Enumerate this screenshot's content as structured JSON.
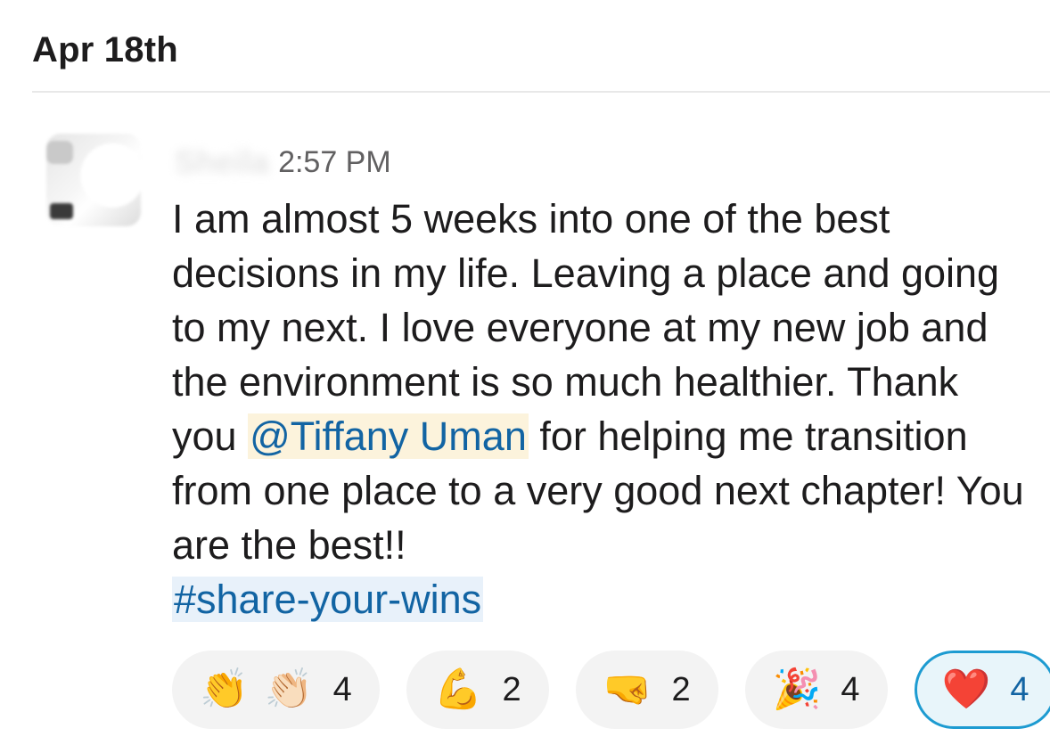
{
  "date_header": "Apr 18th",
  "message": {
    "sender_name": "Sheila",
    "timestamp": "2:57 PM",
    "body_before_mention": "I am almost 5 weeks into one of the best decisions in my life. Leaving a place and going to my next. I love everyone at my new job and the environment is so much healthier. Thank you ",
    "mention": "@Tiffany Uman",
    "body_after_mention": " for helping me transition from one place to a very good next chapter! You are the best!!",
    "channel": "#share-your-wins"
  },
  "reactions": [
    {
      "emojis": [
        "👏",
        "👏🏻"
      ],
      "names": [
        "clap-icon",
        "clap-light-icon"
      ],
      "count": "4",
      "active": false
    },
    {
      "emojis": [
        "💪"
      ],
      "names": [
        "flexed-biceps-icon"
      ],
      "count": "2",
      "active": false
    },
    {
      "emojis": [
        "🤜"
      ],
      "names": [
        "right-fist-icon"
      ],
      "count": "2",
      "active": false
    },
    {
      "emojis": [
        "🎉"
      ],
      "names": [
        "party-popper-icon"
      ],
      "count": "4",
      "active": false
    },
    {
      "emojis": [
        "❤️"
      ],
      "names": [
        "heart-icon"
      ],
      "count": "4",
      "active": true
    }
  ],
  "colors": {
    "link": "#1264a3",
    "mention_bg": "#fcf3dc",
    "channel_bg": "#e8f1fa",
    "active_reaction_border": "#1d9bd1"
  }
}
